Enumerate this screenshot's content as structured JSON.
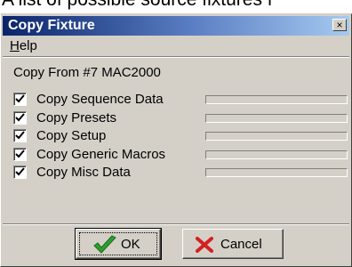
{
  "caption": "A list of possible source fixtures f",
  "window": {
    "title": "Copy Fixture",
    "close_glyph": "×"
  },
  "menu": {
    "help_first": "H",
    "help_rest": "elp"
  },
  "copy_from": "Copy From #7 MAC2000",
  "options": [
    {
      "label": "Copy Sequence Data",
      "checked": true,
      "progress": 0
    },
    {
      "label": "Copy Presets",
      "checked": true,
      "progress": 0
    },
    {
      "label": "Copy Setup",
      "checked": true,
      "progress": 0
    },
    {
      "label": "Copy Generic Macros",
      "checked": true,
      "progress": 0
    },
    {
      "label": "Copy Misc Data",
      "checked": true,
      "progress": 0
    }
  ],
  "buttons": {
    "ok_label": "OK",
    "ok_icon": "green-checkmark-icon",
    "cancel_label": "Cancel",
    "cancel_icon": "red-x-icon"
  },
  "colors": {
    "titlebar_start": "#0a246a",
    "titlebar_end": "#a6caf0",
    "dialog_face": "#d4d0c8",
    "ok_icon": "#2e9e2e",
    "cancel_icon": "#d42020"
  }
}
